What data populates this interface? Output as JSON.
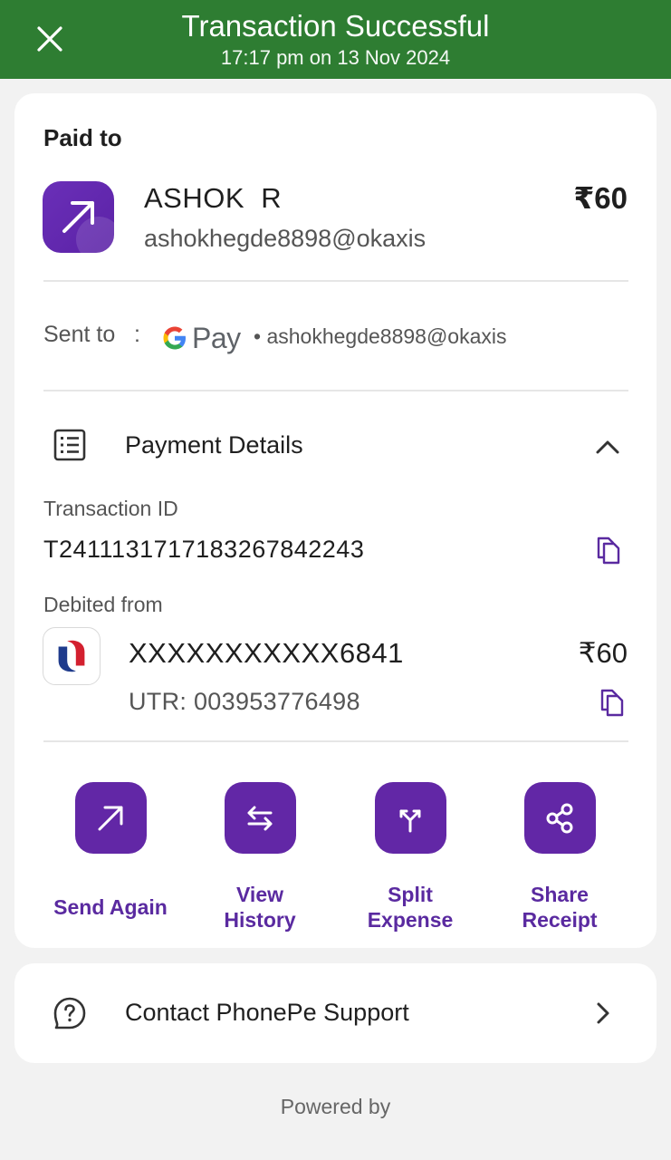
{
  "header": {
    "title": "Transaction Successful",
    "subtitle": "17:17 pm on 13 Nov 2024",
    "bg_color": "#2e7d32",
    "close_icon": "close-icon"
  },
  "paid_to": {
    "heading": "Paid to",
    "name": "ASHOK  R",
    "vpa": "ashokhegde8898@okaxis",
    "amount": "₹60",
    "avatar_icon": "arrow-up-right-icon"
  },
  "sent_to": {
    "label": "Sent to",
    "colon": ":",
    "app_logo_text_g": "G",
    "app_logo_text_pay": "Pay",
    "vpa": "• ashokhegde8898@okaxis"
  },
  "payment_details": {
    "title": "Payment Details",
    "icon": "receipt-list-icon",
    "collapse_icon": "chevron-up-icon",
    "transaction_id_label": "Transaction ID",
    "transaction_id": "T2411131717183267842243",
    "debited_from_label": "Debited from",
    "account_number": "XXXXXXXXXXX6841",
    "debit_amount": "₹60",
    "utr": "UTR: 003953776498",
    "bank_logo_icon": "union-bank-logo-icon"
  },
  "actions": [
    {
      "label": "Send Again",
      "icon": "arrow-up-right-icon"
    },
    {
      "label": "View History",
      "label_line1": "View",
      "label_line2": "History",
      "icon": "swap-arrows-icon"
    },
    {
      "label": "Split Expense",
      "label_line1": "Split",
      "label_line2": "Expense",
      "icon": "split-icon"
    },
    {
      "label": "Share Receipt",
      "label_line1": "Share",
      "label_line2": "Receipt",
      "icon": "share-icon"
    }
  ],
  "support": {
    "label": "Contact PhonePe Support",
    "icon": "help-chat-icon",
    "chevron": "chevron-right-icon"
  },
  "footer": {
    "powered_by": "Powered by"
  },
  "colors": {
    "accent_purple": "#6227a6",
    "success_green": "#2e7d32"
  }
}
